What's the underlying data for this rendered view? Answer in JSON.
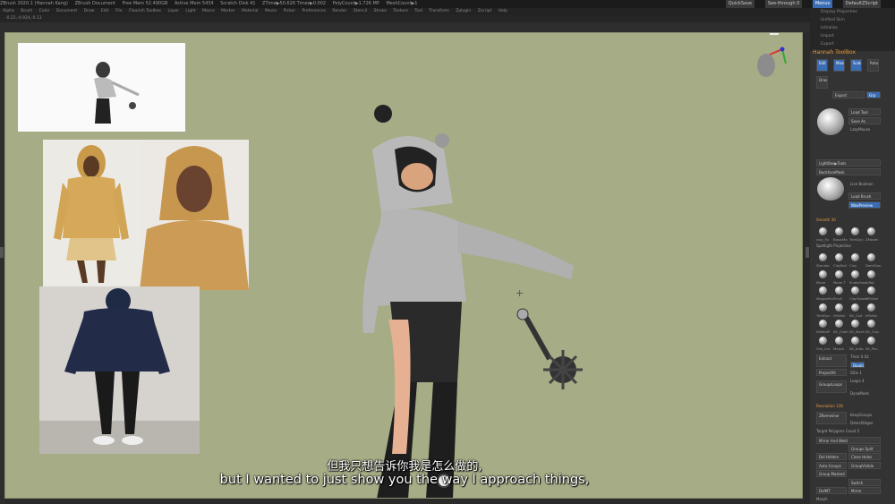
{
  "titlebar": {
    "items": [
      "ZBrush 2020.1 (Hannah Kang)",
      "ZBrush Document",
      "Free Mem 52.490GB",
      "Active Mem 5434",
      "Scratch Disk 41",
      "ZTime▶50.626 Timer▶0.002",
      "PolyCount▶1.726 MP",
      "MeshCount▶1"
    ],
    "quicksave": "QuickSave",
    "seethrough": "See-through  0",
    "menus": "Menus",
    "defaultscript": "DefaultZScript"
  },
  "menubar": [
    "Alpha",
    "Brush",
    "Color",
    "Document",
    "Draw",
    "Edit",
    "File",
    "Flourish Toolbox",
    "Layer",
    "Light",
    "Macro",
    "Marker",
    "Material",
    "Movie",
    "Picker",
    "Preferences",
    "Render",
    "Stencil",
    "Stroke",
    "Texture",
    "Tool",
    "Transform",
    "Zplugin",
    "Zscript",
    "Help"
  ],
  "subbar": "-0.22,-0.924,-0.13",
  "rightmenu": [
    "Display Properties",
    "Unified Skin",
    "Initialize",
    "Import",
    "Export"
  ],
  "panel": {
    "title": "Hannah ToolBox",
    "buttons": [
      "Edit",
      "Move",
      "Scale",
      "Rotate",
      "Draw"
    ],
    "export": "Export",
    "grp": "Grp",
    "load_tool": "Load Tool",
    "save_as": "Save As",
    "lazymouse": "LazyMouse",
    "lightbox_tools": "LightBox▶Tools",
    "backfacemask": "BackfaceMask",
    "live_boolean": "Live Boolean",
    "load_brush": "Load Brush",
    "wavpreview": "WaxPreview",
    "smooth": "Smooth 30",
    "spotlight": "Spotlight Projection",
    "brush_names": [
      "clay_Fo",
      "BasicMa",
      "TrimDyn",
      "ZModel",
      "Standar",
      "ClayBuil",
      "Clay",
      "DamStan",
      "Move",
      "Move T",
      "Snakehoo",
      "Inflat",
      "MagnetFo",
      "Pinch",
      "ClayTubes",
      "MPolish",
      "TrimDyn",
      "hPolish",
      "SK_Clot",
      "hPolish",
      "hMetalP",
      "SK_Cloth",
      "SK_Slash",
      "SK_Clay",
      "Orb_Cra",
      "Morph",
      "SK_Ardb",
      "SK_Pen"
    ],
    "extract": "Extract",
    "double": "Double",
    "thick": "Thick 0.02",
    "projectall": "ProjectAll",
    "sdiv": "SDiv 1",
    "grouplines": "GroupsLoops",
    "loops": "Loops 4",
    "dynamesh": "DynaMesh",
    "resolution": "Resolution 128",
    "zremesher": "ZRemesher",
    "keepgroups": "KeepGroups",
    "detectedges": "DetectEdges",
    "target_poly": "Target Polygons Count 5",
    "mirror_weld": "Mirror And Weld",
    "groups_split": "Groups Split",
    "del_hidden": "Del Hidden",
    "close_holes": "Close Holes",
    "auto_groups": "Auto Groups",
    "group_visible": "GroupVisible",
    "group_masked": "Group Masked",
    "switch": "Switch",
    "delmt": "DelMT",
    "mirror": "Mirror",
    "morph": "Morph"
  },
  "subtitles": {
    "chinese": "但我只想告诉你我是怎么做的,",
    "english": "but I wanted to just show you the way I approach things,"
  },
  "colors": {
    "canvas": "#a6ac86",
    "accent": "#3a6db3",
    "orange": "#e89a3a"
  }
}
